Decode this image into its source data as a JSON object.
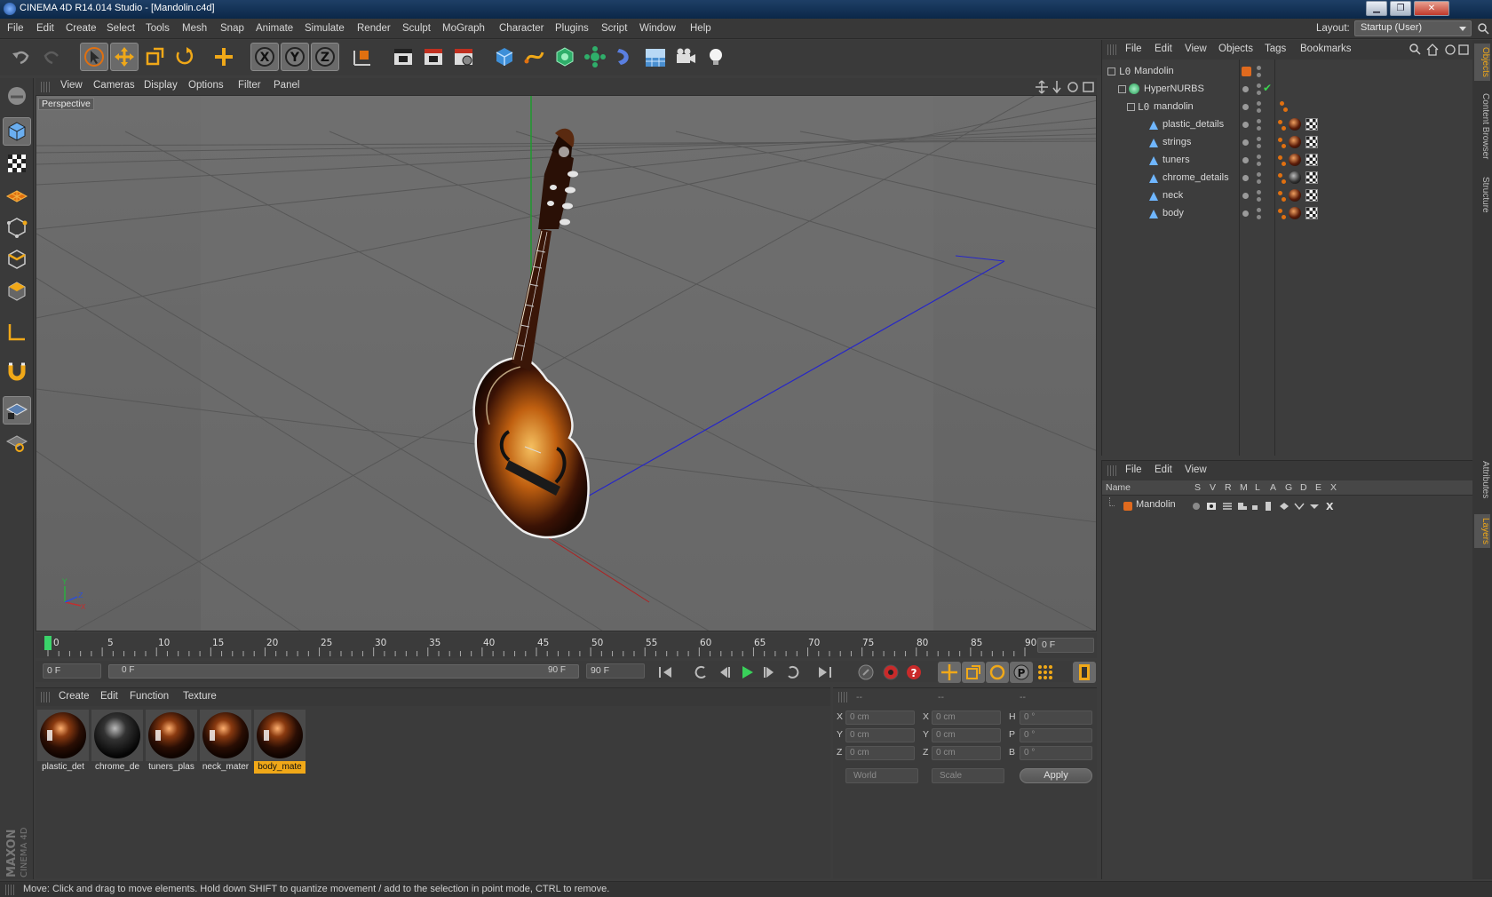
{
  "window": {
    "title": "CINEMA 4D R14.014 Studio - [Mandolin.c4d]",
    "minimize": "▁",
    "maximize": "❐",
    "close": "✕"
  },
  "menu": [
    "File",
    "Edit",
    "Create",
    "Select",
    "Tools",
    "Mesh",
    "Snap",
    "Animate",
    "Simulate",
    "Render",
    "Sculpt",
    "MoGraph",
    "Character",
    "Plugins",
    "Script",
    "Window",
    "Help"
  ],
  "layout": {
    "label": "Layout:",
    "value": "Startup (User)"
  },
  "viewport": {
    "menu": [
      "View",
      "Cameras",
      "Display",
      "Options",
      "Filter",
      "Panel"
    ],
    "label": "Perspective",
    "axis_y": "Y",
    "axis_z": "Z",
    "axis_x": "X"
  },
  "timeline": {
    "ticks": [
      "0",
      "5",
      "10",
      "15",
      "20",
      "25",
      "30",
      "35",
      "40",
      "45",
      "50",
      "55",
      "60",
      "65",
      "70",
      "75",
      "80",
      "85",
      "90"
    ],
    "current_frame": "0 F"
  },
  "transport": {
    "start": "0 F",
    "range_start": "0 F",
    "range_end": "90 F",
    "end": "90 F"
  },
  "materials": {
    "menu": [
      "Create",
      "Edit",
      "Function",
      "Texture"
    ],
    "items": [
      {
        "label": "plastic_det",
        "dark": false
      },
      {
        "label": "chrome_de",
        "dark": true
      },
      {
        "label": "tuners_plas",
        "dark": false
      },
      {
        "label": "neck_mater",
        "dark": false
      },
      {
        "label": "body_mate",
        "dark": false,
        "selected": true
      }
    ]
  },
  "coordinates": {
    "header": [
      "--",
      "--",
      "--"
    ],
    "rows": [
      {
        "a": "X",
        "av": "0 cm",
        "b": "X",
        "bv": "0 cm",
        "c": "H",
        "cv": "0 °"
      },
      {
        "a": "Y",
        "av": "0 cm",
        "b": "Y",
        "bv": "0 cm",
        "c": "P",
        "cv": "0 °"
      },
      {
        "a": "Z",
        "av": "0 cm",
        "b": "Z",
        "bv": "0 cm",
        "c": "B",
        "cv": "0 °"
      }
    ],
    "space": "World",
    "mode": "Scale",
    "apply": "Apply"
  },
  "objects": {
    "menu": [
      "File",
      "Edit",
      "View",
      "Objects",
      "Tags",
      "Bookmarks"
    ],
    "tree": [
      {
        "name": "Mandolin",
        "type": "null"
      },
      {
        "name": "HyperNURBS",
        "type": "nurbs",
        "check": "✔"
      },
      {
        "name": "mandolin",
        "type": "null"
      },
      {
        "name": "plastic_details",
        "type": "poly"
      },
      {
        "name": "strings",
        "type": "poly"
      },
      {
        "name": "tuners",
        "type": "poly"
      },
      {
        "name": "chrome_details",
        "type": "poly"
      },
      {
        "name": "neck",
        "type": "poly"
      },
      {
        "name": "body",
        "type": "poly"
      }
    ]
  },
  "layers": {
    "menu": [
      "File",
      "Edit",
      "View"
    ],
    "columns": [
      "Name",
      "S",
      "V",
      "R",
      "M",
      "L",
      "A",
      "G",
      "D",
      "E",
      "X"
    ],
    "rows": [
      {
        "name": "Mandolin",
        "color": "#e06a1e"
      }
    ]
  },
  "right_tabs": [
    "Objects",
    "Content Browser",
    "Structure",
    "Attributes",
    "Layers"
  ],
  "brand": {
    "maxon": "MAXON",
    "product": "CINEMA 4D"
  },
  "status": "Move: Click and drag to move elements. Hold down SHIFT to quantize movement / add to the selection in point mode, CTRL to remove.",
  "colors": {
    "accent": "#f0a818",
    "selected_tool": "#6a6a6a"
  }
}
